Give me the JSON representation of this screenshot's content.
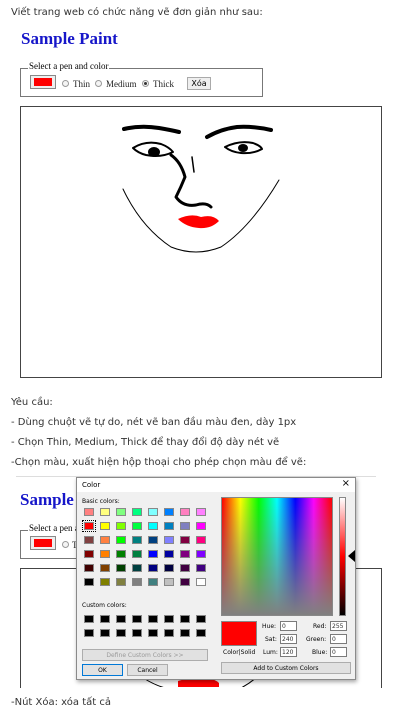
{
  "intro": "Viết trang web có chức năng vẽ đơn giản như sau:",
  "app": {
    "title": "Sample Paint",
    "legend": "Select a pen and color",
    "color_value": "#ff0000",
    "radios": [
      {
        "label": "Thin",
        "checked": false
      },
      {
        "label": "Medium",
        "checked": false
      },
      {
        "label": "Thick",
        "checked": true
      }
    ],
    "clear_label": "Xóa"
  },
  "requirements": {
    "heading": "Yêu cầu:",
    "items": [
      "- Dùng chuột vẽ tự do, nét vẽ ban đầu màu đen, dày 1px",
      "- Chọn Thin, Medium, Thick để thay đổi độ dày nét vẽ",
      "-Chọn màu, xuất hiện hộp thoại cho phép chọn màu để vẽ:"
    ],
    "footer": "-Nút Xóa: xóa tất cả"
  },
  "second": {
    "title": "Sample",
    "legend": "Select a pen a",
    "radio_partial": "T"
  },
  "dialog": {
    "title": "Color",
    "close": "×",
    "basic_label": "Basic colors:",
    "custom_label": "Custom colors:",
    "define_label": "Define Custom Colors >>",
    "ok_label": "OK",
    "cancel_label": "Cancel",
    "colorsolid_label": "Color|Solid",
    "add_label": "Add to Custom Colors",
    "hue_label": "Hue:",
    "hue_value": "0",
    "sat_label": "Sat:",
    "sat_value": "240",
    "lum_label": "Lum:",
    "lum_value": "120",
    "red_label": "Red:",
    "red_value": "255",
    "green_label": "Green:",
    "green_value": "0",
    "blue_label": "Blue:",
    "blue_value": "0",
    "basic_colors": [
      "#ff8080",
      "#ffff80",
      "#80ff80",
      "#00ff80",
      "#80ffff",
      "#0080ff",
      "#ff80c0",
      "#ff80ff",
      "#ff0000",
      "#ffff00",
      "#80ff00",
      "#00ff40",
      "#00ffff",
      "#0080c0",
      "#8080c0",
      "#ff00ff",
      "#804040",
      "#ff8040",
      "#00ff00",
      "#008080",
      "#004080",
      "#8080ff",
      "#800040",
      "#ff0080",
      "#800000",
      "#ff8000",
      "#008000",
      "#008040",
      "#0000ff",
      "#0000a0",
      "#800080",
      "#8000ff",
      "#400000",
      "#804000",
      "#004000",
      "#004040",
      "#000080",
      "#000040",
      "#400040",
      "#400080",
      "#000000",
      "#808000",
      "#808040",
      "#808080",
      "#408080",
      "#c0c0c0",
      "#400040",
      "#ffffff"
    ],
    "selected_color": "#ff0000"
  }
}
